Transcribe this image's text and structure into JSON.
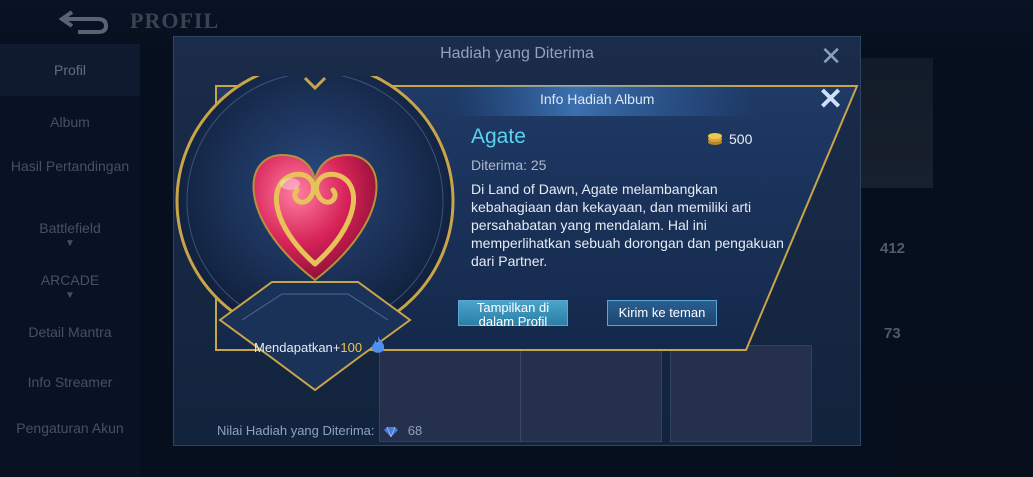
{
  "header": {
    "back_icon": "back-arrow-icon",
    "title": "PROFIL"
  },
  "sidebar": {
    "items": [
      {
        "label": "Profil",
        "active": true
      },
      {
        "label": "Album"
      },
      {
        "label": "Hasil Pertandingan"
      },
      {
        "label": "Battlefield",
        "expand": true
      },
      {
        "label": "ARCADE",
        "expand": true
      },
      {
        "label": "Detail Mantra"
      },
      {
        "label": "Info Streamer"
      },
      {
        "label": "Pengaturan Akun"
      }
    ]
  },
  "background_stats": {
    "followers": "412",
    "likes": "73"
  },
  "gift_dialog": {
    "title": "Hadiah yang Diterima",
    "close_icon": "close-icon",
    "footer_label": "Nilai Hadiah yang Diterima:",
    "footer_value": "68"
  },
  "info_popup": {
    "title": "Info Hadiah Album",
    "close_icon": "close-icon",
    "item_name": "Agate",
    "price": "500",
    "received_label": "Diterima: 25",
    "description": "Di Land of Dawn, Agate melambangkan kebahagiaan dan kekayaan, dan memiliki arti persahabatan yang mendalam. Hal ini memperlihatkan sebuah dorongan dan pengakuan dari Partner.",
    "earn_label": "Mendapatkan+",
    "earn_value": "100",
    "buttons": {
      "show_profile": "Tampilkan di dalam Profil",
      "send_friend": "Kirim ke teman"
    }
  },
  "colors": {
    "accent_cyan": "#5bd2f0",
    "gold": "#c9a54a",
    "heart_red": "#d8245a"
  }
}
